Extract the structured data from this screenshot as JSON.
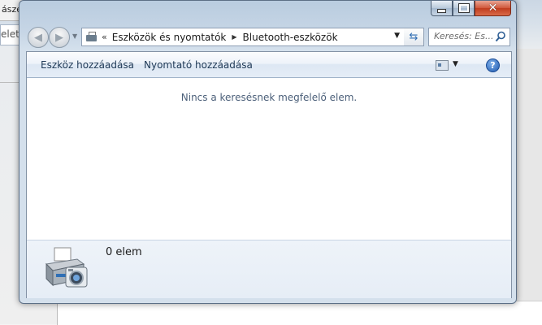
{
  "background": {
    "tab_label": "ászec",
    "address_fragment": "elet/"
  },
  "window": {
    "caption": {
      "minimize": "minimize",
      "maximize": "maximize",
      "close": "close"
    }
  },
  "nav": {
    "back": "back",
    "forward": "forward",
    "separator": "«",
    "breadcrumbs": [
      "Eszközök és nyomtatók",
      "Bluetooth-eszközök"
    ],
    "search_placeholder": "Keresés: Es..."
  },
  "toolbar": {
    "add_device": "Eszköz hozzáadása",
    "add_printer": "Nyomtató hozzáadása",
    "help": "?"
  },
  "content": {
    "empty_message": "Nincs a keresésnek megfelelő elem."
  },
  "details": {
    "count": "0 elem"
  },
  "colors": {
    "link_text": "#1e3956",
    "close_button": "#c03c1e",
    "help_icon": "#1f5ab0"
  }
}
